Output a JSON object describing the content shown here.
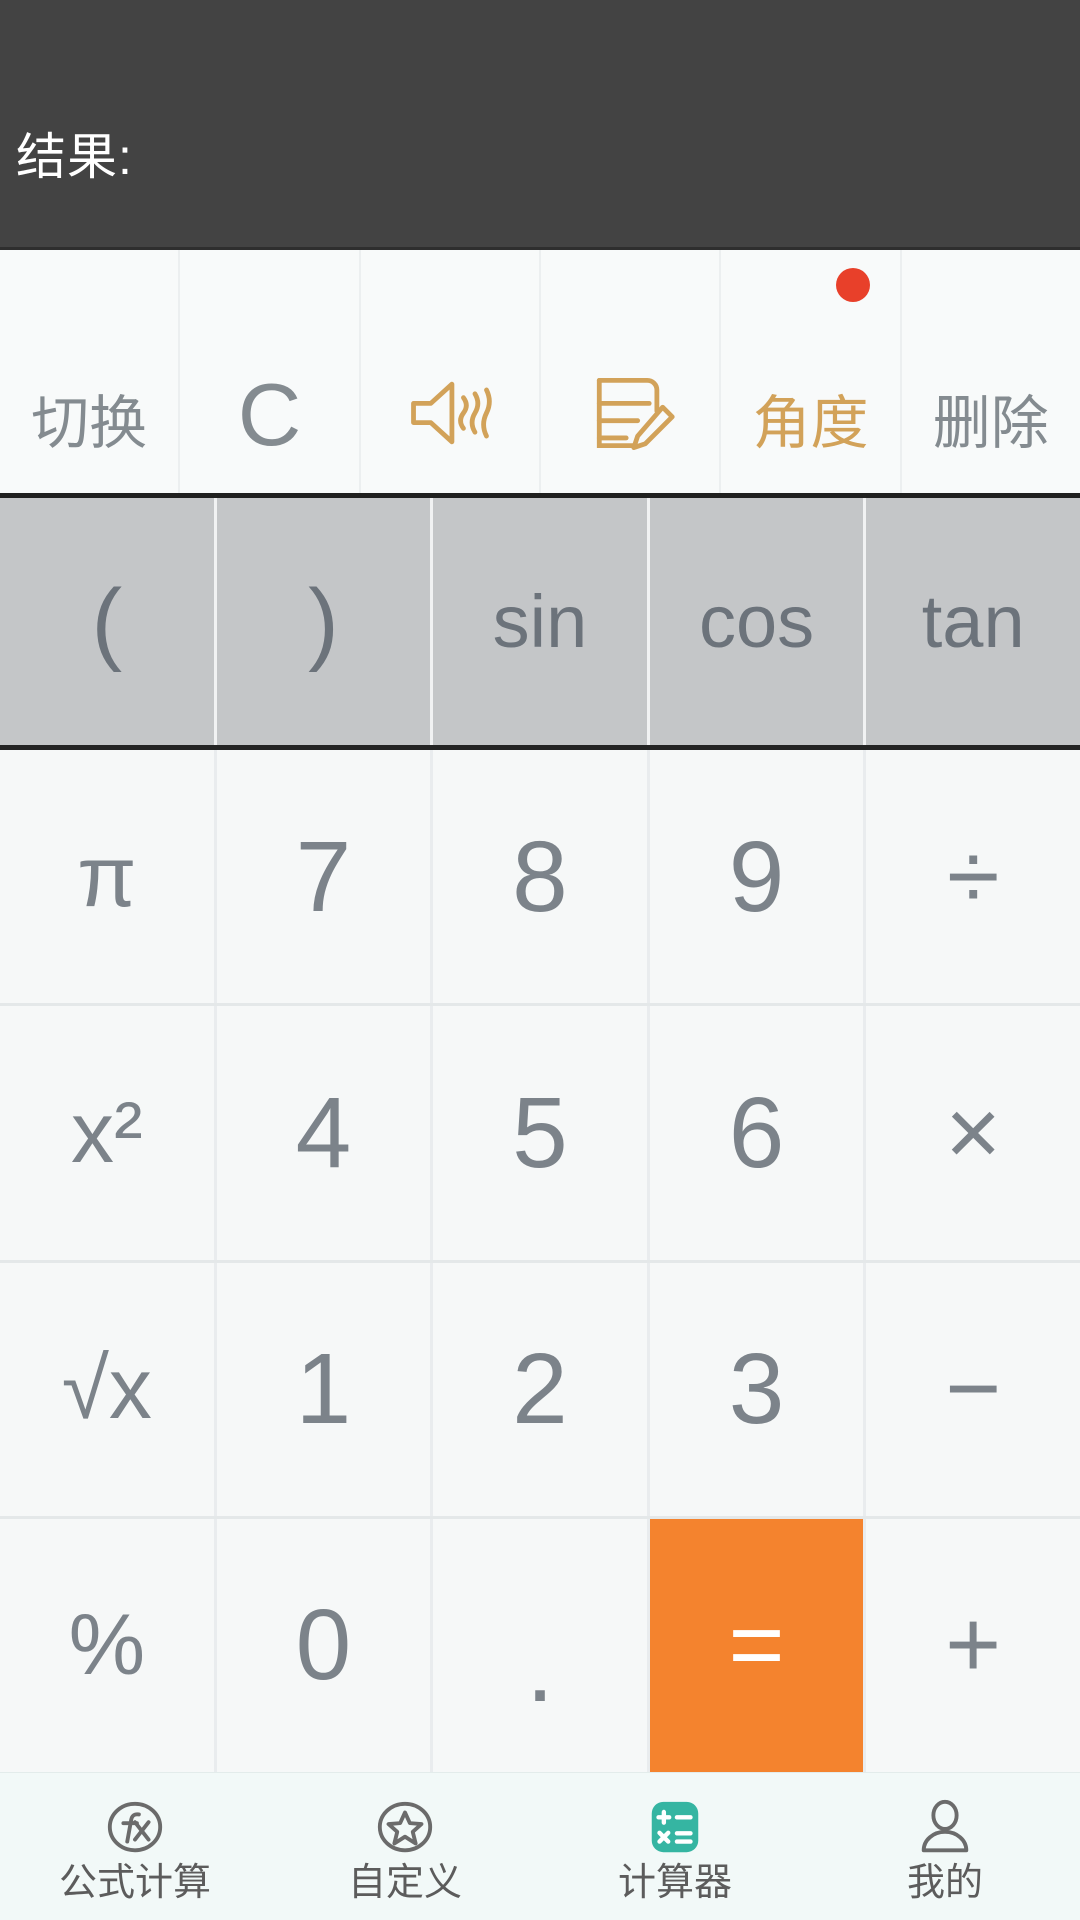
{
  "display": {
    "expression": "",
    "result_label": "结果:"
  },
  "toolbar": {
    "items": [
      {
        "label": "切换",
        "icon": "",
        "style": "text",
        "badge": false
      },
      {
        "label": "C",
        "icon": "",
        "style": "clear",
        "badge": false
      },
      {
        "label": "",
        "icon": "sound-speaker-icon",
        "style": "icon",
        "badge": false
      },
      {
        "label": "",
        "icon": "note-edit-icon",
        "style": "icon",
        "badge": false
      },
      {
        "label": "角度",
        "icon": "",
        "style": "gold",
        "badge": true
      },
      {
        "label": "删除",
        "icon": "",
        "style": "text",
        "badge": false
      }
    ],
    "badge_color": "#e8402a",
    "gold_color": "#d2a259"
  },
  "sci_row": {
    "keys": [
      "(",
      ")",
      "sin",
      "cos",
      "tan"
    ],
    "background": "#c4c6c8"
  },
  "keypad": {
    "rows": [
      [
        {
          "label": "π",
          "kind": "func"
        },
        {
          "label": "7",
          "kind": "digit"
        },
        {
          "label": "8",
          "kind": "digit"
        },
        {
          "label": "9",
          "kind": "digit"
        },
        {
          "label": "÷",
          "kind": "op"
        }
      ],
      [
        {
          "label": "x²",
          "kind": "func"
        },
        {
          "label": "4",
          "kind": "digit"
        },
        {
          "label": "5",
          "kind": "digit"
        },
        {
          "label": "6",
          "kind": "digit"
        },
        {
          "label": "×",
          "kind": "op"
        }
      ],
      [
        {
          "label": "√x",
          "kind": "func"
        },
        {
          "label": "1",
          "kind": "digit"
        },
        {
          "label": "2",
          "kind": "digit"
        },
        {
          "label": "3",
          "kind": "digit"
        },
        {
          "label": "−",
          "kind": "op"
        }
      ],
      [
        {
          "label": "%",
          "kind": "func"
        },
        {
          "label": "0",
          "kind": "digit"
        },
        {
          "label": ".",
          "kind": "dot"
        },
        {
          "label": "=",
          "kind": "equals"
        },
        {
          "label": "+",
          "kind": "op"
        }
      ]
    ],
    "equals_color": "#f4832e"
  },
  "bottom_nav": {
    "items": [
      {
        "label": "公式计算",
        "icon": "fx-formula-icon",
        "active": false
      },
      {
        "label": "自定义",
        "icon": "star-badge-icon",
        "active": false
      },
      {
        "label": "计算器",
        "icon": "calculator-icon",
        "active": true
      },
      {
        "label": "我的",
        "icon": "person-icon",
        "active": false
      }
    ],
    "active_color": "#35b5a2"
  }
}
